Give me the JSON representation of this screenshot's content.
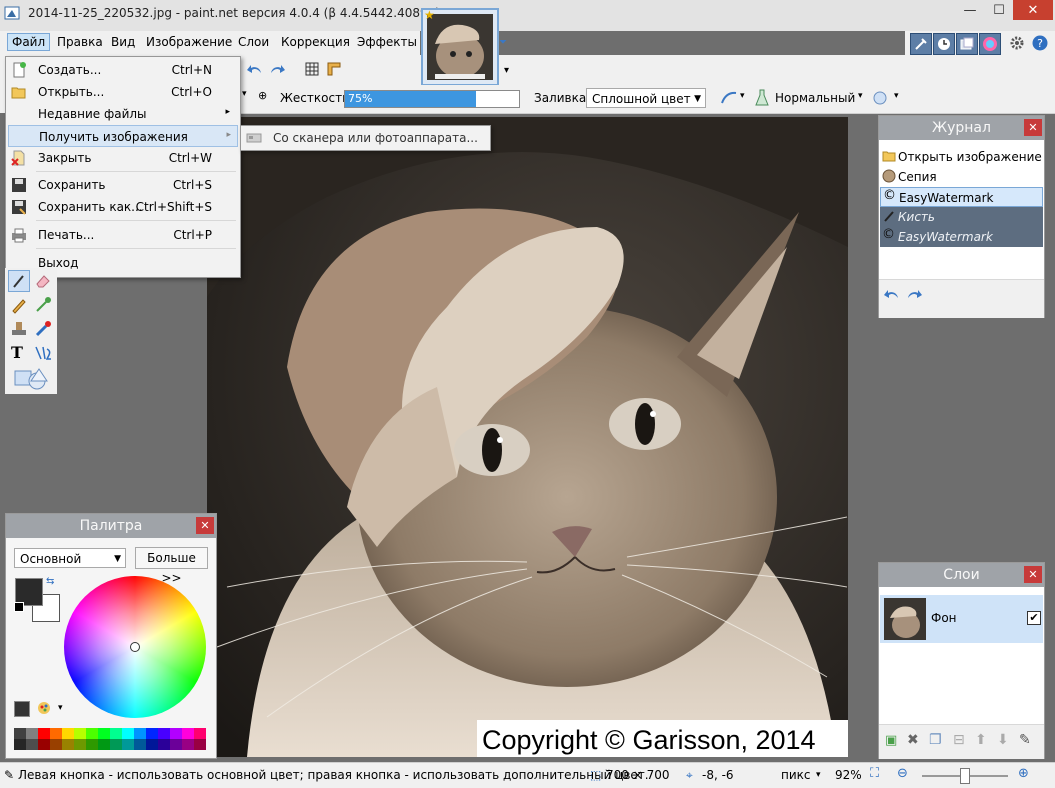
{
  "window": {
    "title": "2014-11-25_220532.jpg - paint.net версия 4.0.4 (β 4.4.5442.40898)",
    "minimize": "—",
    "maximize": "☐",
    "close": "✕"
  },
  "menubar": [
    "Файл",
    "Правка",
    "Вид",
    "Изображение",
    "Слои",
    "Коррекция",
    "Эффекты"
  ],
  "file_menu": {
    "items": [
      {
        "label": "Создать...",
        "shortcut": "Ctrl+N"
      },
      {
        "label": "Открыть...",
        "shortcut": "Ctrl+O"
      },
      {
        "label": "Недавние файлы",
        "shortcut": "▸"
      },
      {
        "label": "Получить изображения",
        "shortcut": "▸"
      },
      {
        "label": "Закрыть",
        "shortcut": "Ctrl+W"
      },
      {
        "label": "Сохранить",
        "shortcut": "Ctrl+S"
      },
      {
        "label": "Сохранить как...",
        "shortcut": "Ctrl+Shift+S"
      },
      {
        "label": "Печать...",
        "shortcut": "Ctrl+P"
      },
      {
        "label": "Выход",
        "shortcut": ""
      }
    ],
    "submenu_item": "Со сканера или фотоаппарата..."
  },
  "toolbar": {
    "hardness_label": "Жесткость:",
    "hardness_value": "75%",
    "hardness_fraction": 0.75,
    "fill_label": "Заливка:",
    "fill_value": "Сплошной цвет",
    "blend_mode": "Нормальный"
  },
  "canvas": {
    "watermark": "Copyright © Garisson, 2014"
  },
  "palette": {
    "title": "Палитра",
    "mode": "Основной",
    "more_button": "Больше >>",
    "primary_color": "#2a2a2a",
    "secondary_color": "#ffffff",
    "swatches": [
      "#404040",
      "#808080",
      "#ff0000",
      "#ff6a00",
      "#ffd800",
      "#b6ff00",
      "#4cff00",
      "#00ff21",
      "#00ff90",
      "#00ffff",
      "#0094ff",
      "#0026ff",
      "#4800ff",
      "#b200ff",
      "#ff00dc",
      "#ff006e"
    ]
  },
  "journal": {
    "title": "Журнал",
    "items": [
      {
        "label": "Открыть изображение",
        "state": "normal"
      },
      {
        "label": "Сепия",
        "state": "normal"
      },
      {
        "label": "EasyWatermark",
        "state": "selected"
      },
      {
        "label": "Кисть",
        "state": "undone"
      },
      {
        "label": "EasyWatermark",
        "state": "undone"
      }
    ]
  },
  "layers": {
    "title": "Слои",
    "items": [
      {
        "label": "Фон",
        "checked": true
      }
    ]
  },
  "statusbar": {
    "hint": "Левая кнопка - использовать основной цвет; правая кнопка - использовать дополнительный цвет.",
    "size": "700 × 700",
    "cursor": "-8, -6",
    "units": "пикс",
    "zoom": "92%"
  }
}
